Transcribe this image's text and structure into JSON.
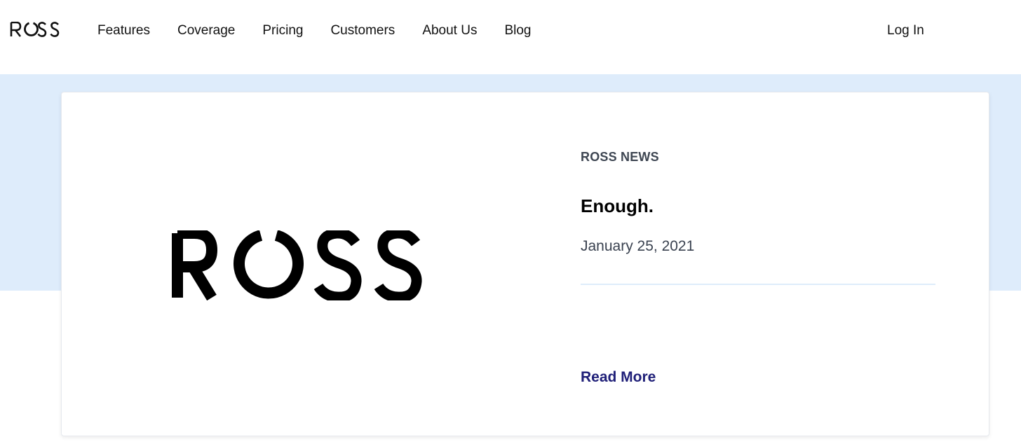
{
  "header": {
    "logo_text": "ROSS",
    "nav": [
      {
        "label": "Features"
      },
      {
        "label": "Coverage"
      },
      {
        "label": "Pricing"
      },
      {
        "label": "Customers"
      },
      {
        "label": "About Us"
      },
      {
        "label": "Blog"
      }
    ],
    "login_label": "Log In"
  },
  "post": {
    "image_logo_text": "ROSS",
    "category": "ROSS NEWS",
    "title": "Enough.",
    "date": "January 25, 2021",
    "read_more_label": "Read More"
  },
  "colors": {
    "band": "#deecfb",
    "read_more": "#1f1f78",
    "category": "#3e4652"
  }
}
